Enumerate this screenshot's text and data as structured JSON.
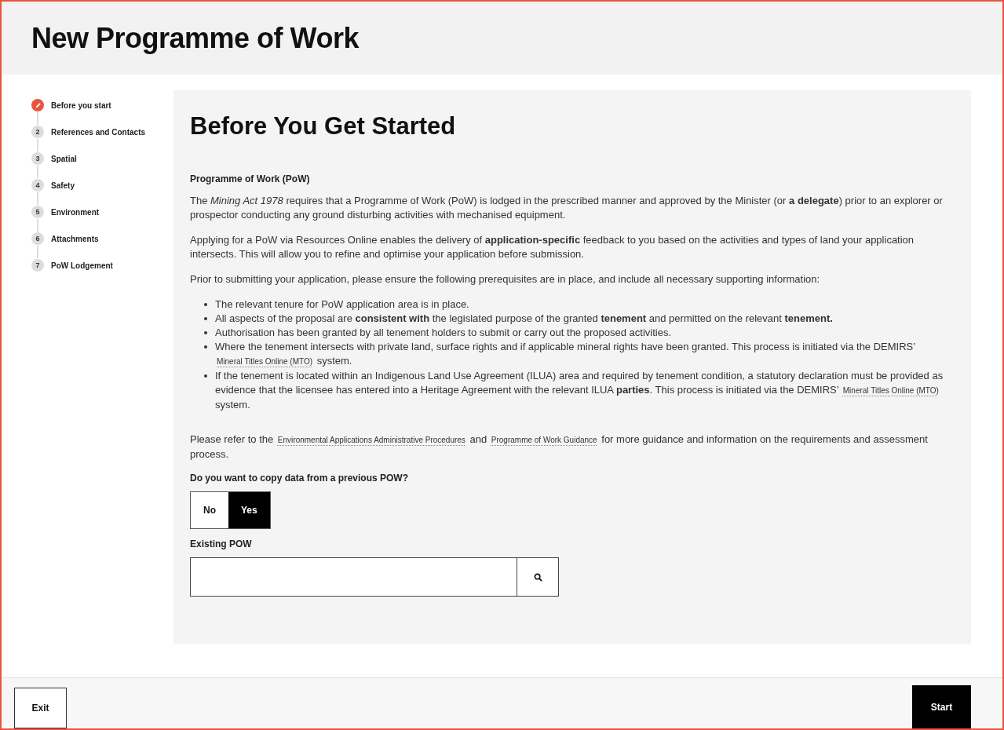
{
  "page_title": "New Programme of Work",
  "steps": [
    {
      "label": "Before you start",
      "selected": true
    },
    {
      "number": "2",
      "label": "References and Contacts",
      "selected": false
    },
    {
      "number": "3",
      "label": "Spatial",
      "selected": false
    },
    {
      "number": "4",
      "label": "Safety",
      "selected": false
    },
    {
      "number": "5",
      "label": "Environment",
      "selected": false
    },
    {
      "number": "6",
      "label": "Attachments",
      "selected": false
    },
    {
      "number": "7",
      "label": "PoW Lodgement",
      "selected": false
    }
  ],
  "section": {
    "heading": "Before You Get Started",
    "subheading": "Programme of Work (PoW)",
    "paragraphs": [
      [
        {
          "text": "The *Mining Act 1978* requires that a Programme of Work (PoW) is lodged in the prescribed manner and approved by the Minister (or **a delegate**) prior to an explorer or prospector conducting any ground disturbing activities with mechanised equipment."
        }
      ],
      [
        {
          "text": "Applying for a PoW via Resources Online enables the delivery of **application-specific** feedback to you based on the activities and types of land your application intersects. This will allow you to refine and optimise your application before submission."
        }
      ],
      [
        {
          "text": "Prior to submitting your application, please ensure the following prerequisites are in place, and include all necessary supporting information:"
        }
      ]
    ],
    "bullets": [
      [
        {
          "text": "The relevant tenure for PoW application area is in place."
        }
      ],
      [
        {
          "text": "All aspects of the proposal are **consistent with** the legislated purpose of the granted **tenement** and permitted on the relevant **tenement.**"
        }
      ],
      [
        {
          "text": "Authorisation has been granted by all tenement holders to submit or carry out the proposed activities."
        }
      ],
      [
        {
          "text": "Where the tenement intersects with private land, surface rights and if applicable mineral rights have been granted. This process is initiated via the DEMIRS’ "
        },
        {
          "link": "Mineral Titles Online (MTO)"
        },
        {
          "text": " system."
        }
      ],
      [
        {
          "text": "If the tenement is located within an Indigenous Land Use Agreement (ILUA) area and required by tenement condition, a statutory declaration must be provided as evidence that the licensee has entered into a Heritage Agreement with the relevant ILUA **parties**. This process is initiated via the DEMIRS’ "
        },
        {
          "link": "Mineral Titles Online (MTO)"
        },
        {
          "text": " system."
        }
      ]
    ],
    "closing": [
      {
        "text": "Please refer to the "
      },
      {
        "link": "Environmental Applications Administrative Procedures"
      },
      {
        "text": " and "
      },
      {
        "link": "Programme of Work Guidance"
      },
      {
        "text": " for more guidance and information on the requirements and assessment process."
      }
    ],
    "copy_question": "Do you want to copy data from a previous POW?",
    "copy_options": [
      {
        "label": "No",
        "selected": false
      },
      {
        "label": "Yes",
        "selected": true
      }
    ],
    "existing_label": "Existing POW"
  },
  "footer": {
    "exit": "Exit",
    "start": "Start"
  }
}
